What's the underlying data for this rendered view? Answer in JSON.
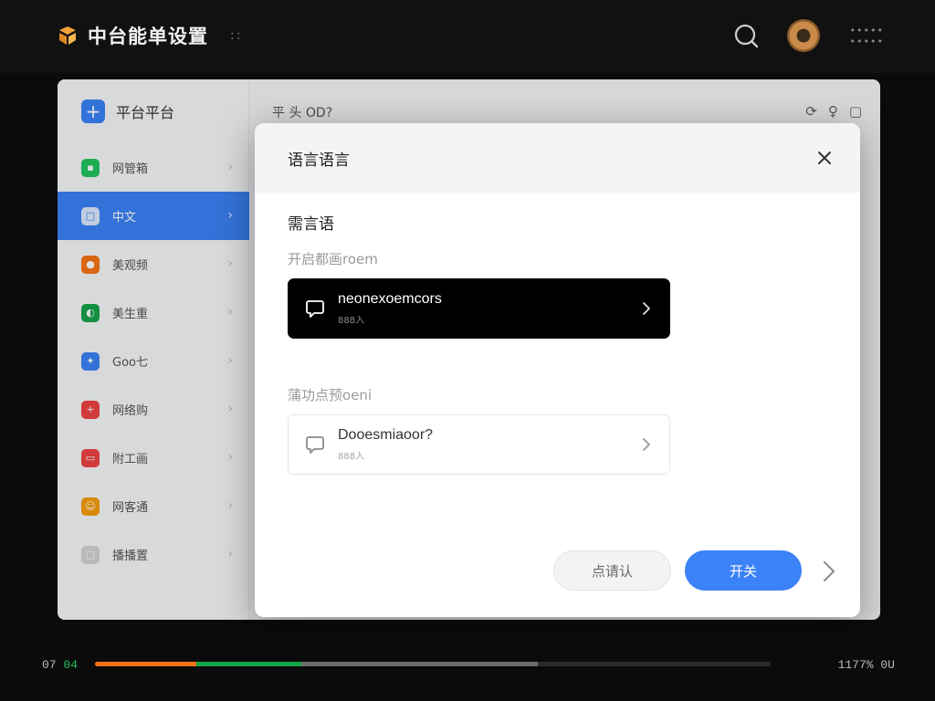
{
  "topbar": {
    "title": "中台能单设置",
    "dots": "::",
    "meta": "•••••\n•••••"
  },
  "app": {
    "sidebar_title": "平台平台",
    "header": "平 头 OD?",
    "header_icons": [
      "⟳",
      "♀",
      "▢"
    ],
    "sidebar_items": [
      {
        "label": "网管箱",
        "icon_color": "#22c55e",
        "icon": "▪"
      },
      {
        "label": "中文",
        "icon_color": "#dbeafe",
        "icon": "□",
        "active": true
      },
      {
        "label": "美观频",
        "icon_color": "#f97316",
        "icon": "●"
      },
      {
        "label": "美生重",
        "icon_color": "#16a34a",
        "icon": "◐"
      },
      {
        "label": "Goo七",
        "icon_color": "#3b82f6",
        "icon": "✦"
      },
      {
        "label": "网络购",
        "icon_color": "#ef4444",
        "icon": "+"
      },
      {
        "label": "附工画",
        "icon_color": "#ef4444",
        "icon": "▭"
      },
      {
        "label": "网客通",
        "icon_color": "#f59e0b",
        "icon": "☺"
      },
      {
        "label": "播播置",
        "icon_color": "#d4d4d8",
        "icon": "▢"
      }
    ]
  },
  "dialog": {
    "title": "语言语言",
    "section_title": "需言语",
    "group1_label": "开启都画roem",
    "group2_label": "蒲功点预oeni",
    "options": [
      {
        "main": "neonexoemcors",
        "sub": "888入",
        "selected": true
      },
      {
        "main": "Dooesmiaoor?",
        "sub": "888入",
        "selected": false
      }
    ],
    "cancel_label": "点请认",
    "confirm_label": "开关"
  },
  "bottombar": {
    "left_label": "07",
    "left_highlight": "04",
    "right_label": "1177% 0U",
    "progress": [
      {
        "color": "#f97316",
        "fraction": 0.15
      },
      {
        "color": "#16a34a",
        "fraction": 0.155
      },
      {
        "color": "#6b6b6b",
        "fraction": 0.35
      }
    ]
  },
  "colors": {
    "accent": "#3b82f6",
    "selected_option_bg": "#000000"
  }
}
